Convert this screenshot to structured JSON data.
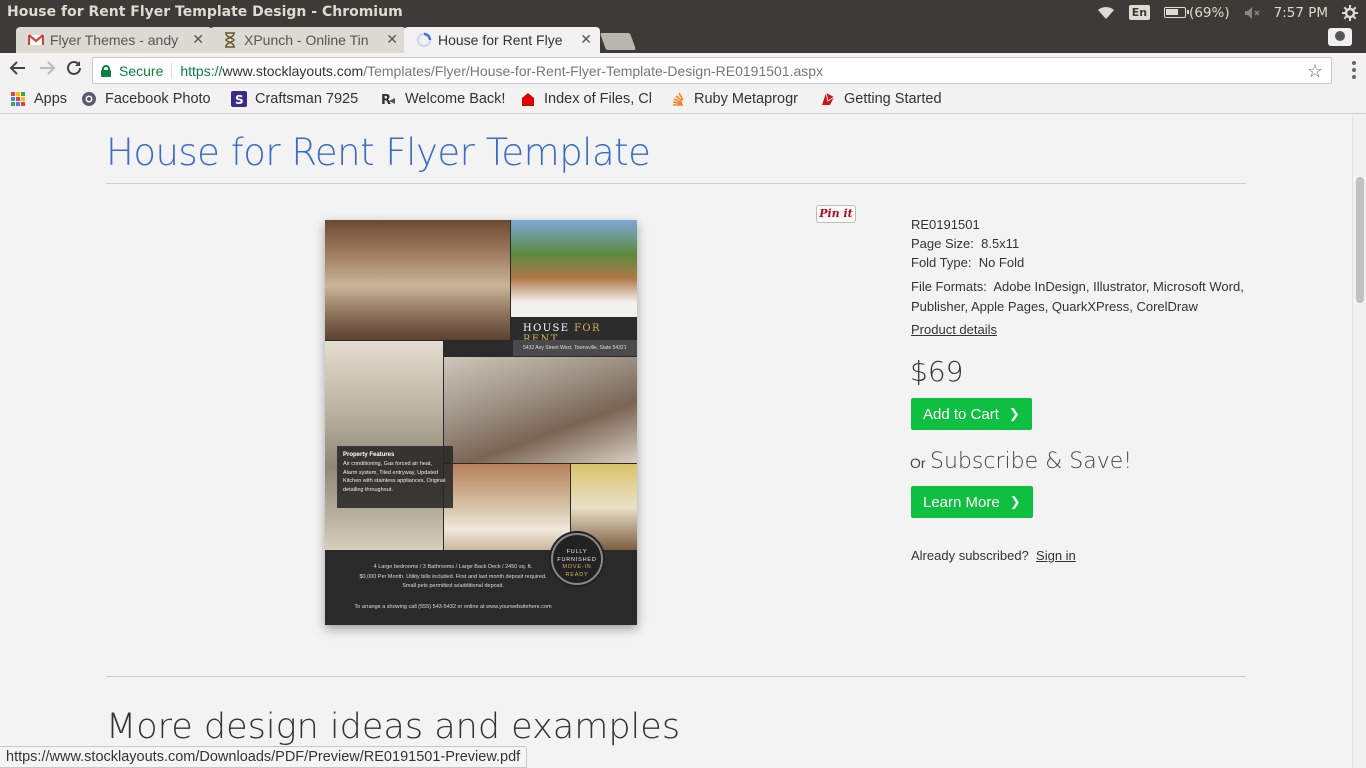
{
  "os": {
    "window_title": "House for Rent Flyer Template Design - Chromium",
    "lang": "En",
    "battery": "(69%)",
    "time": "7:57 PM"
  },
  "tabs": [
    {
      "label": "Flyer Themes - andy",
      "icon": "gmail-icon"
    },
    {
      "label": "XPunch - Online Tin",
      "icon": "hourglass-icon"
    },
    {
      "label": "House for Rent Flye",
      "icon": "loading-icon",
      "active": true
    }
  ],
  "omnibox": {
    "secure_label": "Secure",
    "url_scheme": "https://",
    "url_host": "www.stocklayouts.com",
    "url_path": "/Templates/Flyer/House-for-Rent-Flyer-Template-Design-RE0191501.aspx"
  },
  "bookmarks": [
    {
      "label": "Apps",
      "icon": "apps-grid-icon"
    },
    {
      "label": "Facebook Photo",
      "icon": "camera-icon"
    },
    {
      "label": "Craftsman 7925",
      "icon": "s-logo-icon"
    },
    {
      "label": "Welcome Back!",
      "icon": "pluralsight-icon"
    },
    {
      "label": "Index of Files, Cl",
      "icon": "red-shape-icon"
    },
    {
      "label": "Ruby Metaprogr",
      "icon": "stack-icon"
    },
    {
      "label": "Getting Started",
      "icon": "ruby-icon"
    }
  ],
  "page": {
    "title": "House for Rent Flyer Template",
    "more_title": "More design ideas and examples"
  },
  "flyer": {
    "headline_a": "HOUSE ",
    "headline_b": "FOR RENT",
    "address": "5432 Any Street West, Townsville, State 54321",
    "features_title": "Property Features",
    "features_text": "Air conditioning, Gas forced air heat, Alarm system, Tiled entryway, Updated Kitchen with stainless appliances, Original detailing throughout.",
    "bottom_1": "4 Large bedrooms  /  3 Bathrooms  /  Large Back Deck  /  2450 sq. ft.",
    "bottom_2": "$0,000 Per Month. Utility bills included. First and last month deposit required.",
    "bottom_3": "Small pets permitted w/additional deposit.",
    "bottom_4": "To arrange a showing call  (555) 543-5432  or online at  www.yourwebsitehere.com",
    "badge_1": "FULLY",
    "badge_2": "FURNISHED",
    "badge_3": "MOVE-IN",
    "badge_4": "READY"
  },
  "pinit": "Pin it",
  "product": {
    "sku": "RE0191501",
    "page_size_label": "Page Size:",
    "page_size": "8.5x11",
    "fold_type_label": "Fold Type:",
    "fold_type": "No Fold",
    "file_formats_label": "File Formats:",
    "file_formats_1": "Adobe InDesign, Illustrator, Microsoft Word,",
    "file_formats_2": "Publisher, Apple Pages, QuarkXPress, CorelDraw",
    "details_link": "Product details",
    "price": "$69",
    "add_to_cart": "Add to Cart",
    "or": "Or",
    "subscribe": "Subscribe & Save!",
    "learn_more": "Learn More",
    "already": "Already subscribed?",
    "sign_in": "Sign in"
  },
  "status_url": "https://www.stocklayouts.com/Downloads/PDF/Preview/RE0191501-Preview.pdf",
  "colors": {
    "title_blue": "#3a6bc8",
    "cta_green": "#0fbf40",
    "secure_green": "#0b8043"
  }
}
